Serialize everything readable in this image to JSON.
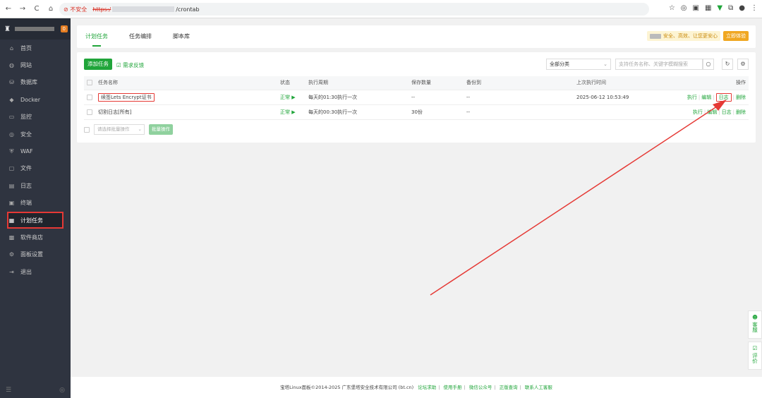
{
  "browser": {
    "nav": [
      "←",
      "→",
      "C",
      "⌂"
    ],
    "security_label": "不安全",
    "url_scheme": "https:/",
    "url_path": "/crontab"
  },
  "sidebar": {
    "badge": "0",
    "items": [
      {
        "label": "首页",
        "icon": "home-icon",
        "glyph": "⌂"
      },
      {
        "label": "网站",
        "icon": "globe-icon",
        "glyph": "◍"
      },
      {
        "label": "数据库",
        "icon": "database-icon",
        "glyph": "⛁"
      },
      {
        "label": "Docker",
        "icon": "docker-icon",
        "glyph": "◆"
      },
      {
        "label": "监控",
        "icon": "monitor-icon",
        "glyph": "▭"
      },
      {
        "label": "安全",
        "icon": "shield-icon",
        "glyph": "◎"
      },
      {
        "label": "WAF",
        "icon": "waf-icon",
        "glyph": "⛨"
      },
      {
        "label": "文件",
        "icon": "folder-icon",
        "glyph": "▢"
      },
      {
        "label": "日志",
        "icon": "log-icon",
        "glyph": "▤"
      },
      {
        "label": "终端",
        "icon": "terminal-icon",
        "glyph": "▣"
      },
      {
        "label": "计划任务",
        "icon": "calendar-icon",
        "glyph": "▦",
        "active": true
      },
      {
        "label": "软件商店",
        "icon": "store-icon",
        "glyph": "▩"
      },
      {
        "label": "面板设置",
        "icon": "gear-icon",
        "glyph": "⚙"
      },
      {
        "label": "退出",
        "icon": "logout-icon",
        "glyph": "⇥"
      }
    ]
  },
  "tabs": [
    "计划任务",
    "任务编排",
    "脚本库"
  ],
  "promo": {
    "text": "安全、高效、让您更安心",
    "button": "立即体验"
  },
  "toolbar": {
    "add_task": "添加任务",
    "feedback": "需求反馈",
    "category": "全部分类",
    "search_placeholder": "支持任务名称、关键字模糊搜索"
  },
  "table": {
    "headers": [
      "任务名称",
      "状态",
      "执行周期",
      "保存数量",
      "备份到",
      "上次执行时间",
      "操作"
    ],
    "rows": [
      {
        "name": "续签Lets Encrypt证书",
        "status": "正常 ▶",
        "cycle": "每天的01:30执行一次",
        "keep": "--",
        "backup": "--",
        "last": "2025-06-12 10:53:49",
        "highlight": true
      },
      {
        "name": "切割日志[所有]",
        "status": "正常 ▶",
        "cycle": "每天的00:30执行一次",
        "keep": "30份",
        "backup": "--",
        "last": "",
        "highlight": false
      }
    ],
    "ops": [
      "执行",
      "编辑",
      "日志",
      "删除"
    ]
  },
  "batch": {
    "placeholder": "请选择批量操作",
    "button": "批量操作"
  },
  "footer": {
    "copyright": "宝塔Linux面板©2014-2025 广东堡塔安全技术有限公司 (bt.cn)",
    "links": [
      "论坛求助",
      "使用手册",
      "微信公众号",
      "正版查询",
      "联系人工客服"
    ]
  },
  "float": {
    "service": "客服",
    "rate": "评价"
  },
  "colors": {
    "accent": "#20a53a",
    "highlight": "#e53935",
    "sidebar": "#2f3440"
  }
}
